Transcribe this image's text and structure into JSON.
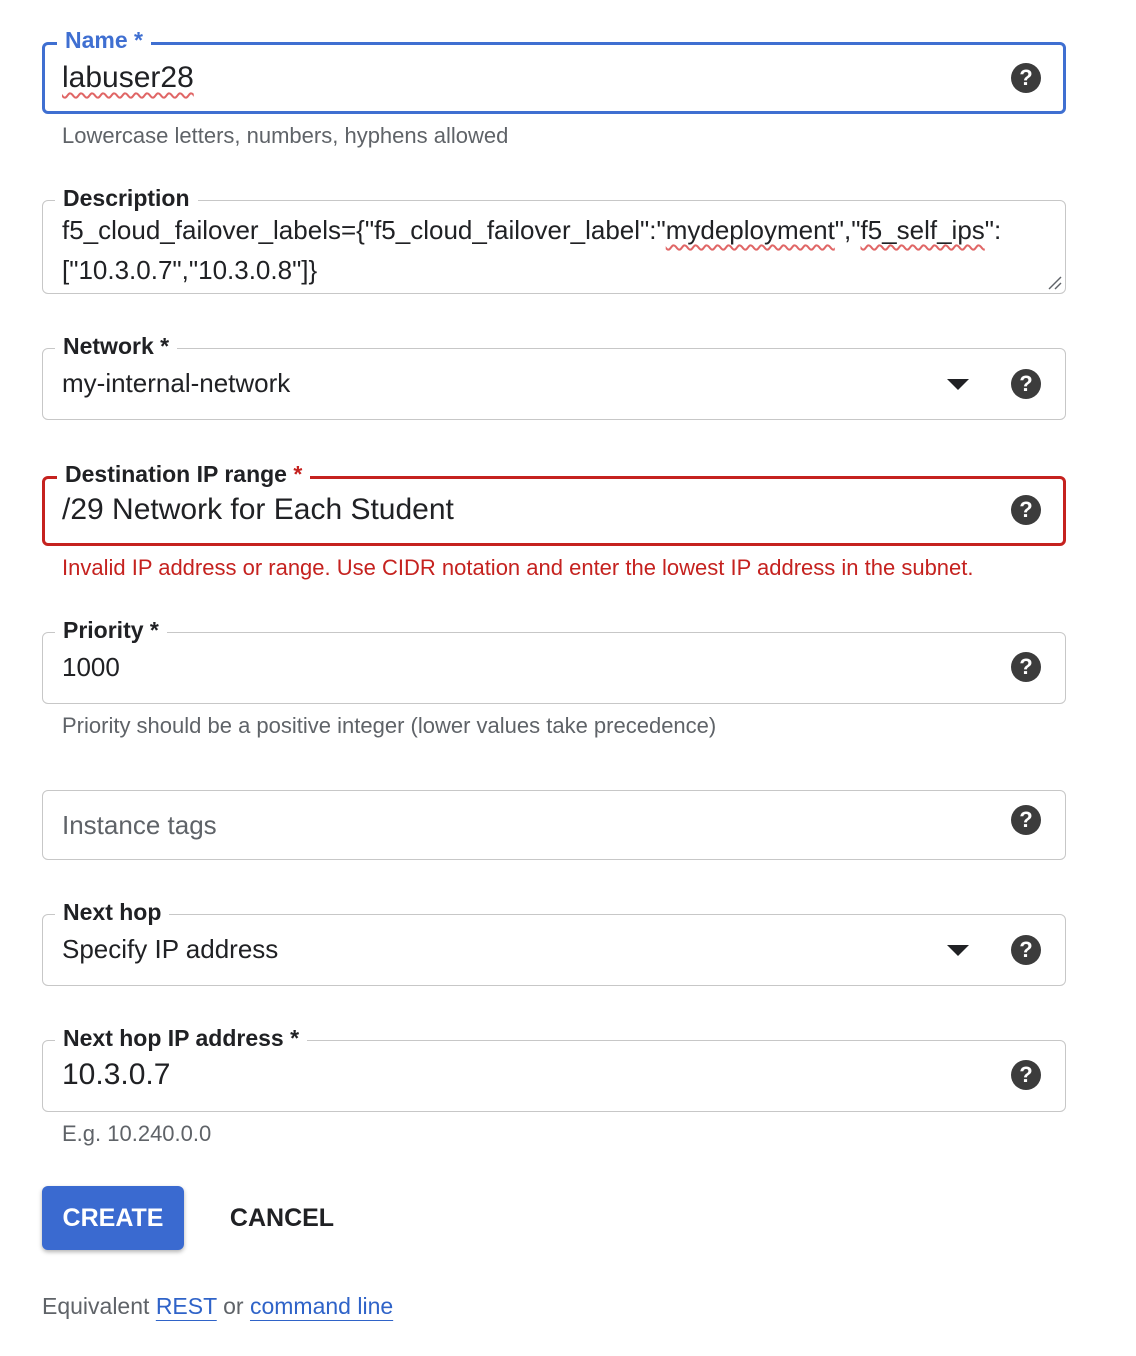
{
  "form": {
    "name": {
      "label": "Name",
      "required_mark": "*",
      "value": "labuser28",
      "hint": "Lowercase letters, numbers, hyphens allowed"
    },
    "description": {
      "label": "Description",
      "line1_prefix": "f5_cloud_failover_labels={\"f5_cloud_failover_label\":\"",
      "line1_word1": "mydeployment",
      "line1_mid": "\",\"",
      "line1_word2": "f5_self_ips",
      "line1_suffix": "\":",
      "line2": "[\"10.3.0.7\",\"10.3.0.8\"]}"
    },
    "network": {
      "label": "Network",
      "required_mark": "*",
      "value": "my-internal-network"
    },
    "destination_ip_range": {
      "label": "Destination IP range",
      "required_mark": "*",
      "value": "/29 Network for Each Student",
      "error": "Invalid IP address or range. Use CIDR notation and enter the lowest IP address in the subnet."
    },
    "priority": {
      "label": "Priority",
      "required_mark": "*",
      "value": "1000",
      "hint": "Priority should be a positive integer (lower values take precedence)"
    },
    "instance_tags": {
      "placeholder": "Instance tags"
    },
    "next_hop": {
      "label": "Next hop",
      "value": "Specify IP address"
    },
    "next_hop_ip": {
      "label": "Next hop IP address",
      "required_mark": "*",
      "value": "10.3.0.7",
      "hint": "E.g. 10.240.0.0"
    },
    "help_icon_glyph": "?"
  },
  "actions": {
    "create_label": "CREATE",
    "cancel_label": "CANCEL"
  },
  "footer": {
    "prefix": "Equivalent",
    "rest_link": "REST",
    "or": "or",
    "command_line_link": "command line"
  },
  "colors": {
    "accent": "#3f6fd1",
    "error": "#c5221f",
    "button": "#3a6ad0",
    "help_icon": "#3c3c3c"
  },
  "icons": [
    "help-icon",
    "dropdown-arrow-icon",
    "resize-grip-icon"
  ]
}
